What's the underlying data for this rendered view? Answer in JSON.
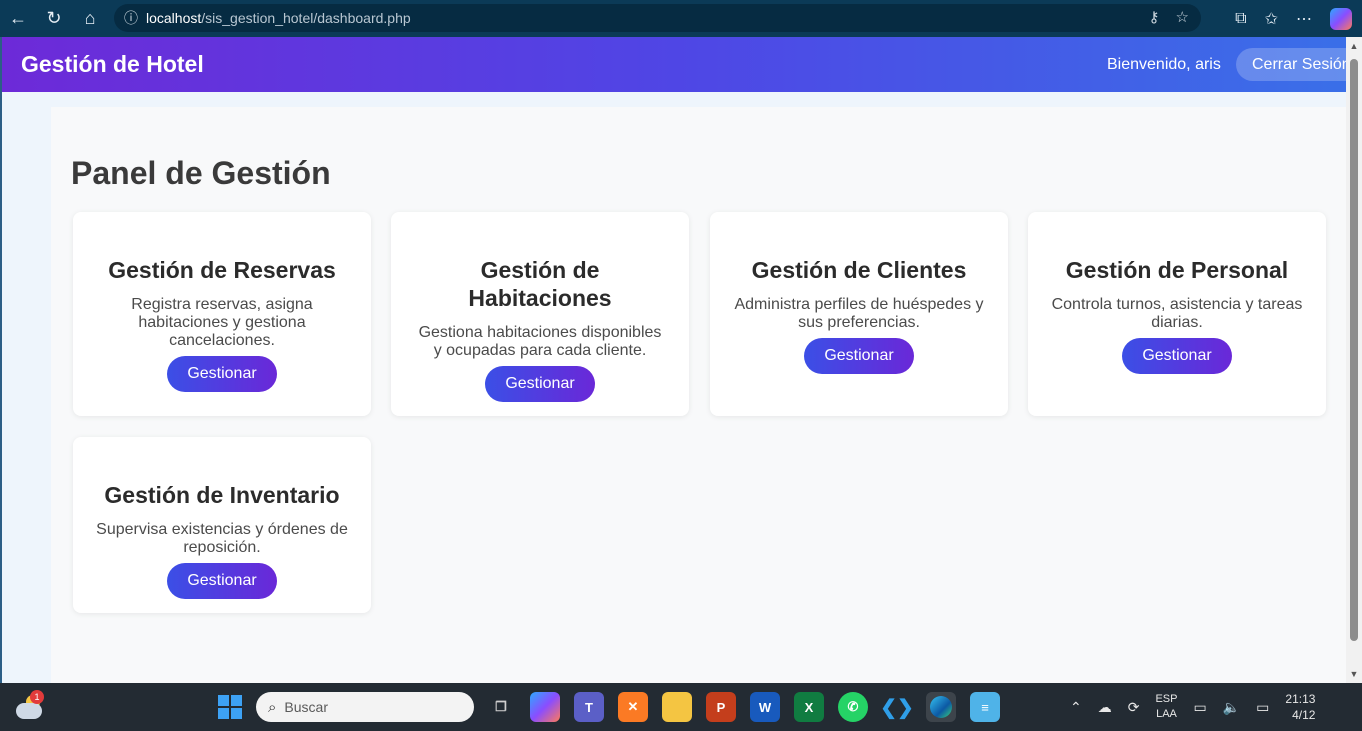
{
  "browser": {
    "url_host": "localhost",
    "url_path": "/sis_gestion_hotel/dashboard.php"
  },
  "header": {
    "brand": "Gestión de Hotel",
    "welcome": "Bienvenido, aris",
    "logout_label": "Cerrar Sesión"
  },
  "main": {
    "title": "Panel de Gestión",
    "cards": [
      {
        "title": "Gestión de Reservas",
        "description": "Registra reservas, asigna habitaciones y gestiona cancelaciones.",
        "button": "Gestionar"
      },
      {
        "title": "Gestión de Habitaciones",
        "description": "Gestiona habitaciones disponibles y ocupadas para cada cliente.",
        "button": "Gestionar"
      },
      {
        "title": "Gestión de Clientes",
        "description": "Administra perfiles de huéspedes y sus preferencias.",
        "button": "Gestionar"
      },
      {
        "title": "Gestión de Personal",
        "description": "Controla turnos, asistencia y tareas diarias.",
        "button": "Gestionar"
      },
      {
        "title": "Gestión de Inventario",
        "description": "Supervisa existencias y órdenes de reposición.",
        "button": "Gestionar"
      }
    ]
  },
  "taskbar": {
    "search_placeholder": "Buscar",
    "weather_badge": "1",
    "lang_top": "ESP",
    "lang_bottom": "LAA",
    "time": "21:13",
    "date": "4/12"
  },
  "colors": {
    "header_start": "#6d2ad8",
    "header_end": "#3a6fe8",
    "button_start": "#3b4fe6",
    "button_end": "#6a28d8"
  }
}
